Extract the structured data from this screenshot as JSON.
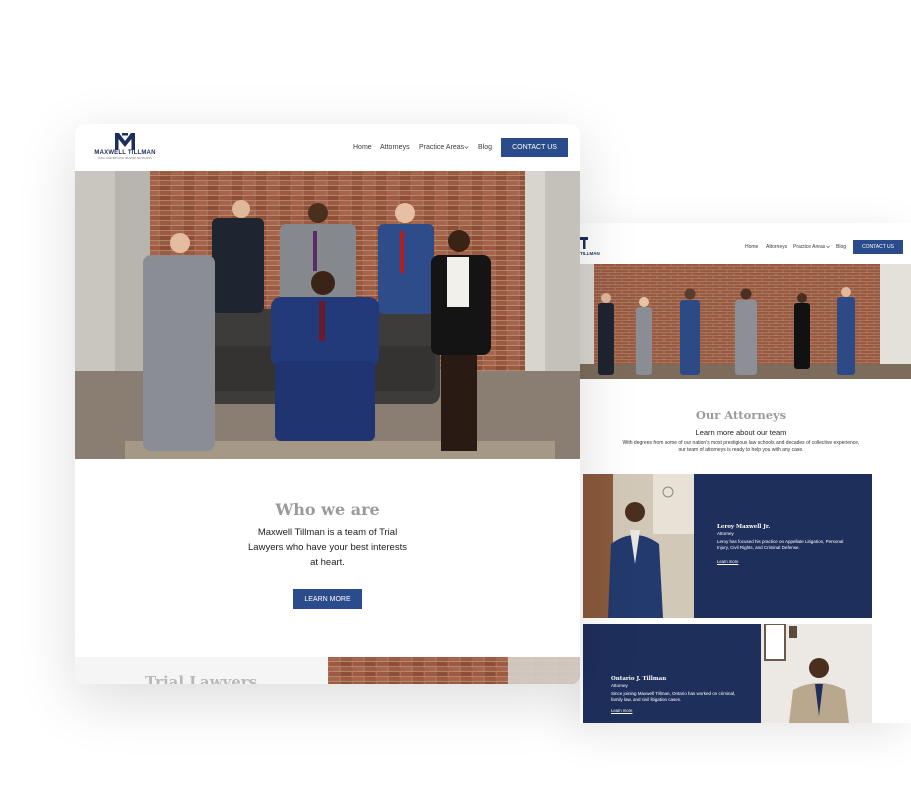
{
  "brand": {
    "name": "MAXWELL TILLMAN",
    "tagline": "TRIAL LAWYERS AND TRUSTED ADVOCATES",
    "name_partial": "TILLMAN"
  },
  "nav": {
    "items": [
      "Home",
      "Attorneys",
      "Practice Areas",
      "Blog"
    ],
    "contact_label": "CONTACT US"
  },
  "home": {
    "who_title": "Who we are",
    "who_text": "Maxwell Tillman is a team of Trial Lawyers who have your best interests at heart.",
    "learn_more": "LEARN MORE",
    "next_section_title": "Trial Lawyers"
  },
  "attorneys_page": {
    "title": "Our Attorneys",
    "subtitle": "Learn more about our team",
    "description": "With degrees from some of our nation's most prestigious law schools and decades of collective experience, our team of attorneys is ready to help you with any case.",
    "cards": [
      {
        "name": "Leroy Maxwell Jr.",
        "role": "Attorney",
        "bio": "Leroy has focused his practice on Appellate Litigation, Personal Injury, Civil Rights, and Criminal Defense.",
        "link": "Learn more"
      },
      {
        "name": "Ontario J. Tillman",
        "role": "Attorney",
        "bio": "Since joining Maxwell Tillman, Ontario has worked on criminal, family law, and civil litigation cases.",
        "link": "Learn more"
      }
    ]
  },
  "colors": {
    "accent": "#2b4c8c",
    "navy": "#1f2f5c",
    "heading_gray": "#9a9a9a",
    "brick": "#8d4a30"
  },
  "icons": {
    "logo": "mt-monogram-icon",
    "dropdown": "chevron-down-icon"
  }
}
